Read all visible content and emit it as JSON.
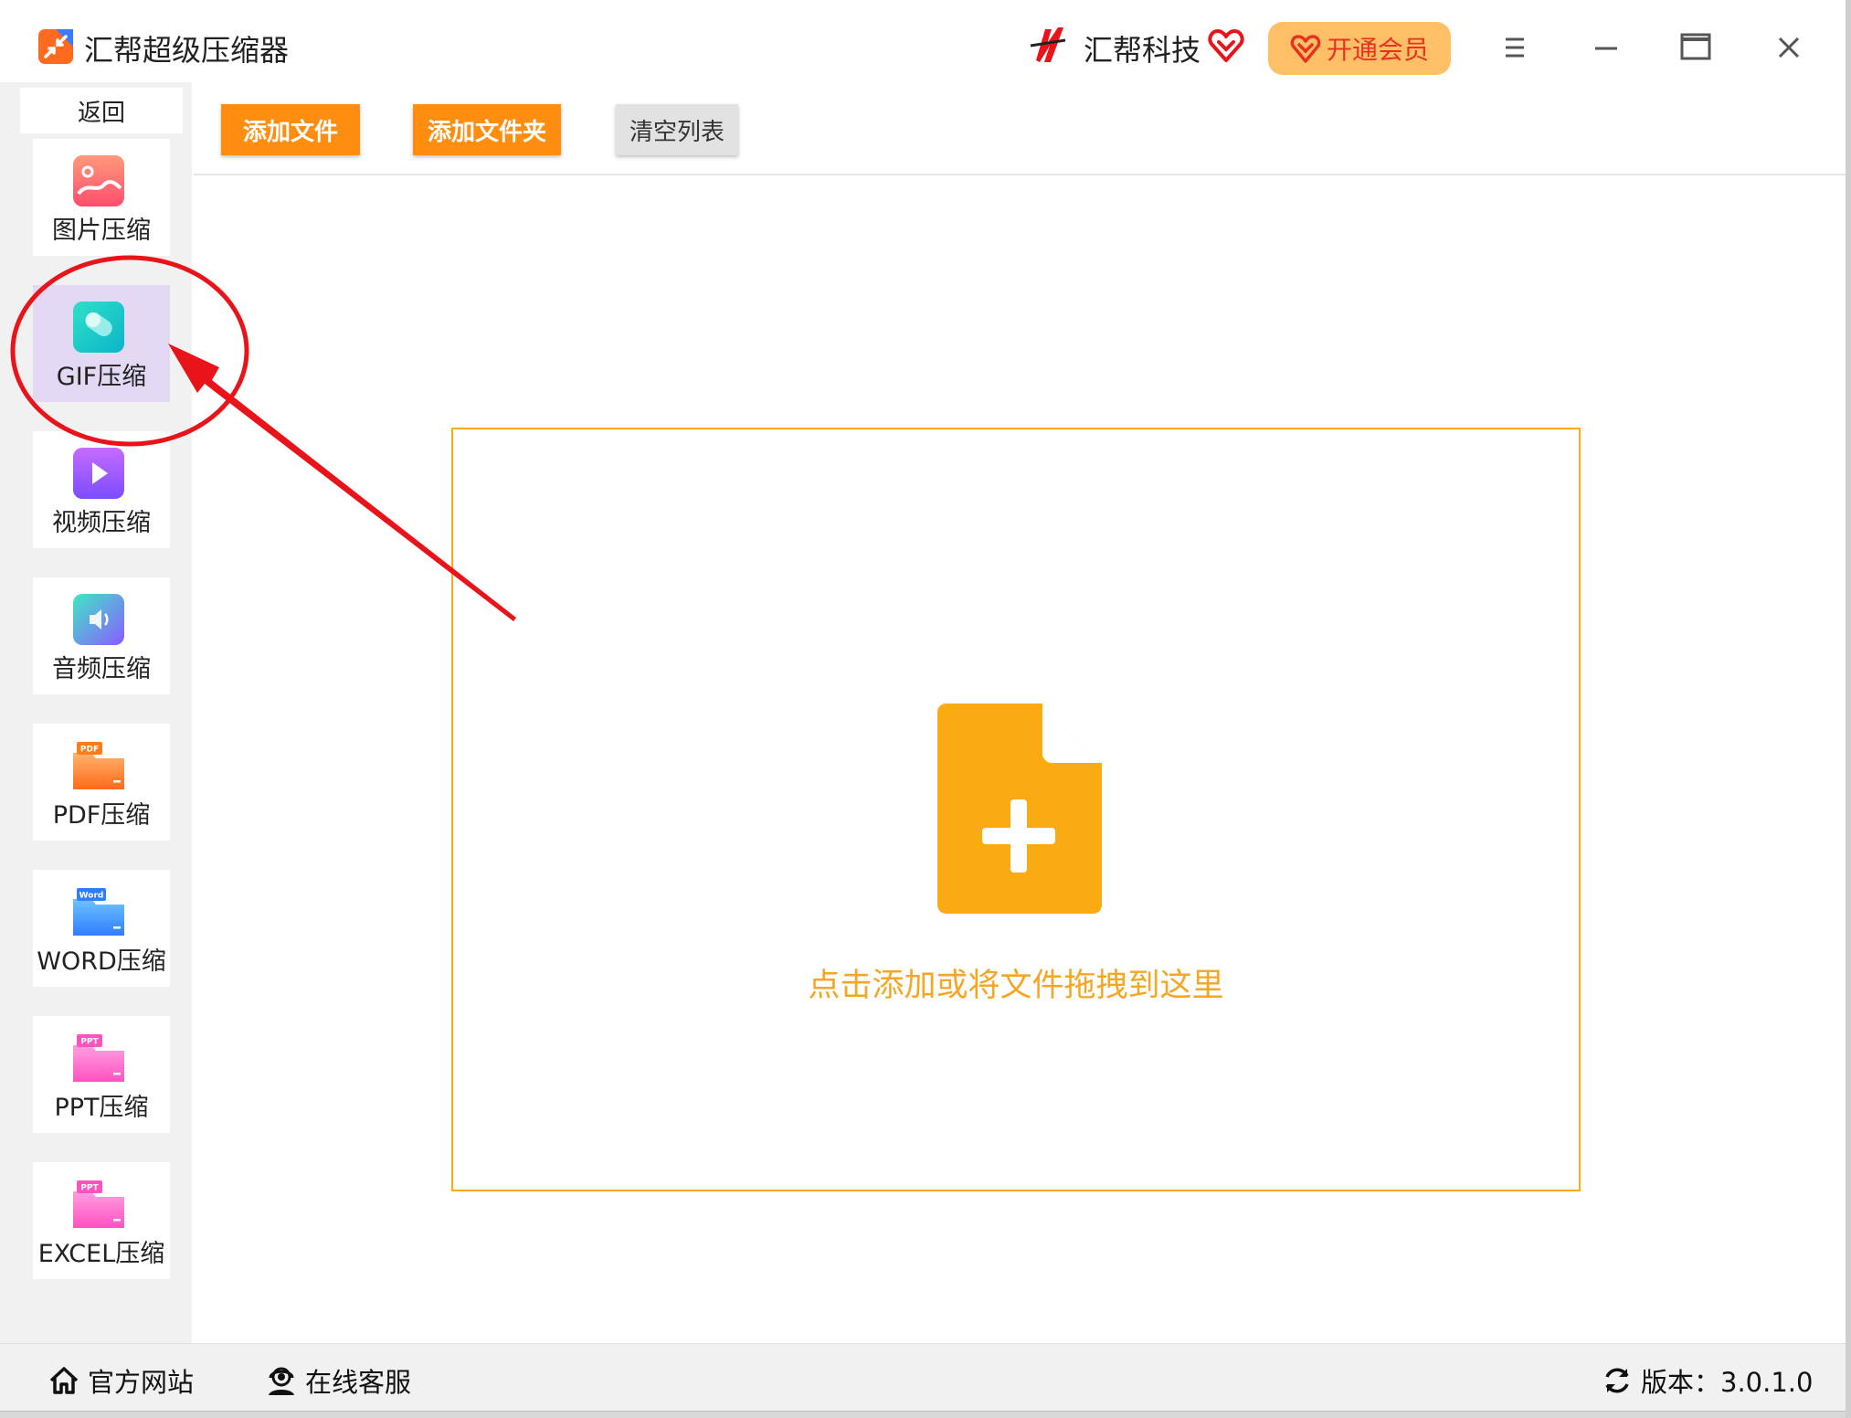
{
  "titlebar": {
    "app_title": "汇帮超级压缩器",
    "brand_name": "汇帮科技",
    "vip_label": "开通会员",
    "icons": [
      "app-logo-icon",
      "brand-logo-icon",
      "heart-icon",
      "diamond-icon",
      "menu-icon",
      "minimize-icon",
      "maximize-icon",
      "close-icon"
    ]
  },
  "sidebar": {
    "back_label": "返回",
    "items": [
      {
        "label": "图片压缩",
        "icon": "image-icon"
      },
      {
        "label": "GIF压缩",
        "icon": "gif-icon",
        "active": true
      },
      {
        "label": "视频压缩",
        "icon": "video-icon"
      },
      {
        "label": "音频压缩",
        "icon": "audio-icon"
      },
      {
        "label": "PDF压缩",
        "icon": "pdf-folder-icon",
        "badge": "PDF"
      },
      {
        "label": "WORD压缩",
        "icon": "word-folder-icon",
        "badge": "Word"
      },
      {
        "label": "PPT压缩",
        "icon": "ppt-folder-icon",
        "badge": "PPT"
      },
      {
        "label": "EXCEL压缩",
        "icon": "excel-folder-icon",
        "badge": "PPT"
      }
    ]
  },
  "toolbar": {
    "add_file": "添加文件",
    "add_folder": "添加文件夹",
    "clear_list": "清空列表"
  },
  "dropzone": {
    "text": "点击添加或将文件拖拽到这里",
    "icon": "file-add-icon"
  },
  "footer": {
    "website": "官方网站",
    "support": "在线客服",
    "version": "版本：3.0.1.0"
  },
  "colors": {
    "accent_orange": "#ff8d0f",
    "dropzone_border": "#ffaa1e",
    "vip_bg": "#ffbf66",
    "annotation_red": "#e8141a",
    "active_item_bg": "#e3d9f4"
  }
}
